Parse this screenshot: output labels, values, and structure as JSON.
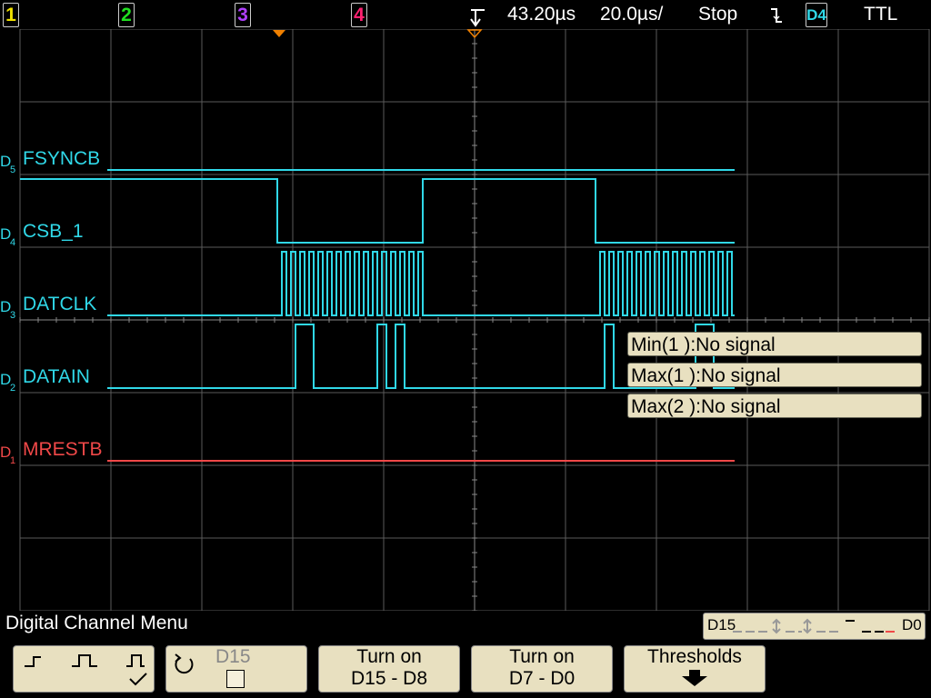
{
  "topbar": {
    "ch1": "1",
    "ch2": "2",
    "ch3": "3",
    "ch4": "4",
    "time_offset": "43.20µs",
    "time_per_div": "20.0µs/",
    "run_state": "Stop",
    "trigger_slope": "falling-edge-icon",
    "trigger_source": "D4",
    "trigger_level": "TTL"
  },
  "colors": {
    "ch1": "#f0e000",
    "ch2": "#20e020",
    "ch3": "#b040ff",
    "ch4": "#ff2070",
    "digital": "#30d8e8",
    "restb": "#f04848",
    "grid": "#5a5a5a",
    "trigger_marker": "#f08000"
  },
  "channels": [
    {
      "id": "D5",
      "label": "FSYNCB"
    },
    {
      "id": "D4",
      "label": "CSB_1"
    },
    {
      "id": "D3",
      "label": "DATCLK"
    },
    {
      "id": "D2",
      "label": "DATAIN"
    },
    {
      "id": "D1",
      "label": "MRESTB"
    }
  ],
  "measurements": [
    "Min(1 ):No signal",
    "Max(1 ):No signal",
    "Max(2 ):No signal"
  ],
  "menu": {
    "title": "Digital Channel Menu",
    "bus_low": "D15",
    "bus_high": "D0",
    "softkeys": {
      "threshold_shape_icons": [
        "low-pulse-icon",
        "high-pulse-icon",
        "checked-pulse-icon"
      ],
      "channel_select_label": "D15",
      "turn_on_high_line1": "Turn on",
      "turn_on_high_line2": "D15 - D8",
      "turn_on_low_line1": "Turn on",
      "turn_on_low_line2": "D7 - D0",
      "thresholds_label": "Thresholds"
    }
  }
}
